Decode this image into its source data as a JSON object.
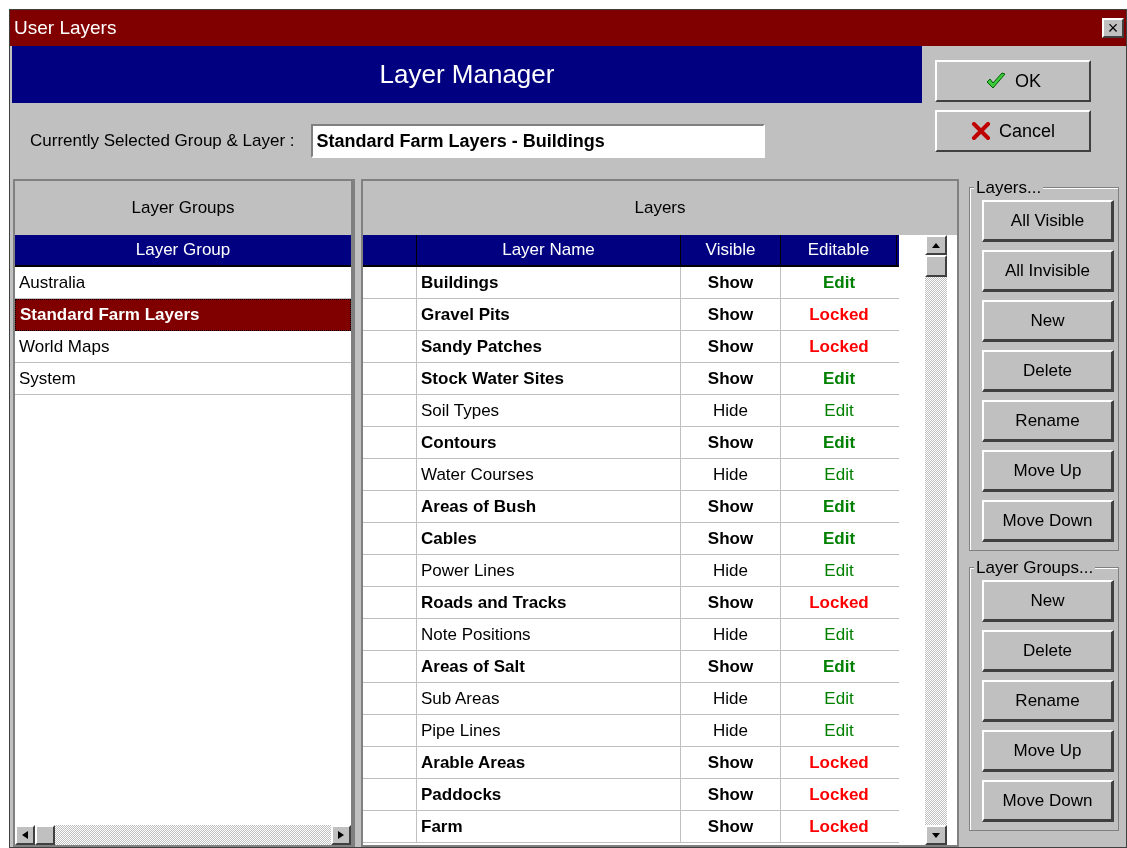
{
  "window": {
    "title": "User Layers",
    "close": "×"
  },
  "header": {
    "title": "Layer Manager"
  },
  "dialog_buttons": [
    {
      "label": "OK",
      "kind": "ok"
    },
    {
      "label": "Cancel",
      "kind": "cancel"
    }
  ],
  "current": {
    "label": "Currently Selected Group & Layer  :",
    "value": "Standard Farm Layers - Buildings"
  },
  "groups_panel": {
    "title": "Layer Groups",
    "column": "Layer Group",
    "items": [
      {
        "name": "Australia",
        "selected": false
      },
      {
        "name": "Standard Farm Layers",
        "selected": true
      },
      {
        "name": "World Maps",
        "selected": false
      },
      {
        "name": "System",
        "selected": false
      }
    ]
  },
  "layers_panel": {
    "title": "Layers",
    "columns": [
      "Layer Name",
      "Visible",
      "Editable"
    ],
    "rows": [
      {
        "name": "Buildings",
        "visible": "Show",
        "shown": true,
        "editable": "Edit",
        "locked": false
      },
      {
        "name": "Gravel Pits",
        "visible": "Show",
        "shown": true,
        "editable": "Locked",
        "locked": true
      },
      {
        "name": "Sandy Patches",
        "visible": "Show",
        "shown": true,
        "editable": "Locked",
        "locked": true
      },
      {
        "name": "Stock Water Sites",
        "visible": "Show",
        "shown": true,
        "editable": "Edit",
        "locked": false
      },
      {
        "name": "Soil Types",
        "visible": "Hide",
        "shown": false,
        "editable": "Edit",
        "locked": false
      },
      {
        "name": "Contours",
        "visible": "Show",
        "shown": true,
        "editable": "Edit",
        "locked": false
      },
      {
        "name": "Water Courses",
        "visible": "Hide",
        "shown": false,
        "editable": "Edit",
        "locked": false
      },
      {
        "name": "Areas of Bush",
        "visible": "Show",
        "shown": true,
        "editable": "Edit",
        "locked": false
      },
      {
        "name": "Cables",
        "visible": "Show",
        "shown": true,
        "editable": "Edit",
        "locked": false
      },
      {
        "name": "Power Lines",
        "visible": "Hide",
        "shown": false,
        "editable": "Edit",
        "locked": false
      },
      {
        "name": "Roads and Tracks",
        "visible": "Show",
        "shown": true,
        "editable": "Locked",
        "locked": true
      },
      {
        "name": "Note Positions",
        "visible": "Hide",
        "shown": false,
        "editable": "Edit",
        "locked": false
      },
      {
        "name": "Areas of Salt",
        "visible": "Show",
        "shown": true,
        "editable": "Edit",
        "locked": false
      },
      {
        "name": "Sub Areas",
        "visible": "Hide",
        "shown": false,
        "editable": "Edit",
        "locked": false
      },
      {
        "name": "Pipe Lines",
        "visible": "Hide",
        "shown": false,
        "editable": "Edit",
        "locked": false
      },
      {
        "name": "Arable Areas",
        "visible": "Show",
        "shown": true,
        "editable": "Locked",
        "locked": true
      },
      {
        "name": "Paddocks",
        "visible": "Show",
        "shown": true,
        "editable": "Locked",
        "locked": true
      },
      {
        "name": "Farm",
        "visible": "Show",
        "shown": true,
        "editable": "Locked",
        "locked": true
      }
    ]
  },
  "layer_actions": {
    "title": "Layers...",
    "buttons": [
      "All Visible",
      "All Invisible",
      "New",
      "Delete",
      "Rename",
      "Move Up",
      "Move Down"
    ]
  },
  "group_actions": {
    "title": "Layer Groups...",
    "buttons": [
      "New",
      "Delete",
      "Rename",
      "Move Up",
      "Move Down"
    ]
  }
}
